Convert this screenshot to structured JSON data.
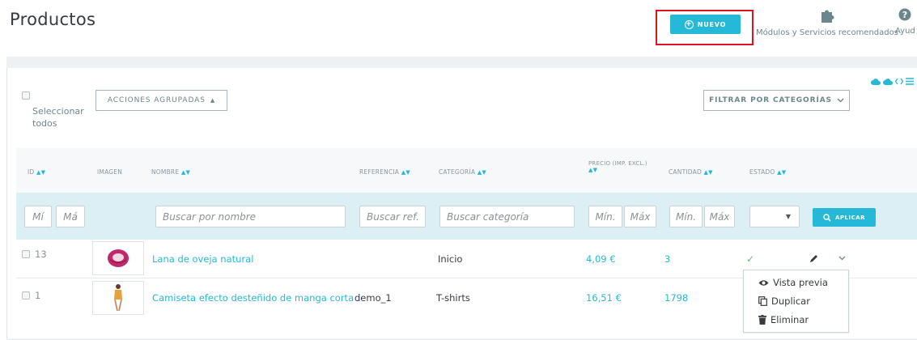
{
  "header": {
    "title": "Productos",
    "new_button": "NUEVO",
    "modules_label": "Módulos y Servicios recomendados",
    "help_label": "Ayud"
  },
  "toolbar": {
    "select_all": "Seleccionar todos",
    "bulk_actions": "ACCIONES AGRUPADAS",
    "filter_category": "FILTRAR POR CATEGORÍAS"
  },
  "columns": {
    "id": "ID",
    "image": "IMAGEN",
    "name": "NOMBRE",
    "reference": "REFERENCIA",
    "category": "CATEGORÍA",
    "price_line1": "PRECIO (IMP. EXCL.)",
    "quantity": "CANTIDAD",
    "status": "ESTADO"
  },
  "filters": {
    "id_min": "Mí",
    "id_max": "Má",
    "name_placeholder": "Buscar por nombre",
    "ref_placeholder": "Buscar ref.",
    "cat_placeholder": "Buscar categoría",
    "price_min": "Mín.",
    "price_max": "Máx",
    "qty_min": "Mín.",
    "qty_max": "Máx",
    "apply": "APLICAR"
  },
  "products": [
    {
      "id": "13",
      "name": "Lana de oveja natural",
      "reference": "",
      "category": "Inicio",
      "price": "4,09 €",
      "quantity": "3",
      "thumb": "yarn-image"
    },
    {
      "id": "1",
      "name": "Camiseta efecto desteñido de manga corta",
      "reference": "demo_1",
      "category": "T-shirts",
      "price": "16,51 €",
      "quantity": "1798",
      "thumb": "tshirt-image"
    }
  ],
  "row_menu": {
    "preview": "Vista previa",
    "duplicate": "Duplicar",
    "delete": "Eliminar"
  },
  "colors": {
    "accent": "#25b9d7",
    "highlight": "#e0141e",
    "success": "#70b580"
  }
}
